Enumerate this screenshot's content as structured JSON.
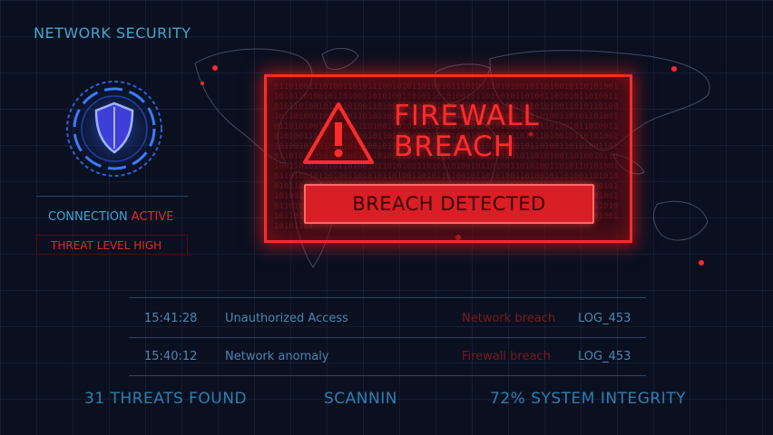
{
  "header": {
    "title": "NETWORK SECURITY"
  },
  "status": {
    "connection_label": "CONNECTION",
    "connection_value": "ACTIVE",
    "threat_level": "THREAT LEVEL HIGH"
  },
  "alert": {
    "line1": "FIREWALL",
    "line2": "BREACH",
    "button_label": "BREACH DETECTED"
  },
  "logs": [
    {
      "time": "15:41:28",
      "message": "Unauthorized Access",
      "type": "Network breach",
      "id": "LOG_453"
    },
    {
      "time": "15:40:12",
      "message": "Network anomaly",
      "type": "Firewall breach",
      "id": "LOG_453"
    }
  ],
  "footer": {
    "threats": "31 THREATS FOUND",
    "scan": "SCANNIN",
    "integrity": "72%  SYSTEM INTEGRITY"
  },
  "colors": {
    "accent_red": "#ff2b2b",
    "accent_blue": "#4aa3c8",
    "background": "#0a1020"
  },
  "icons": [
    "shield-icon",
    "warning-icon"
  ]
}
